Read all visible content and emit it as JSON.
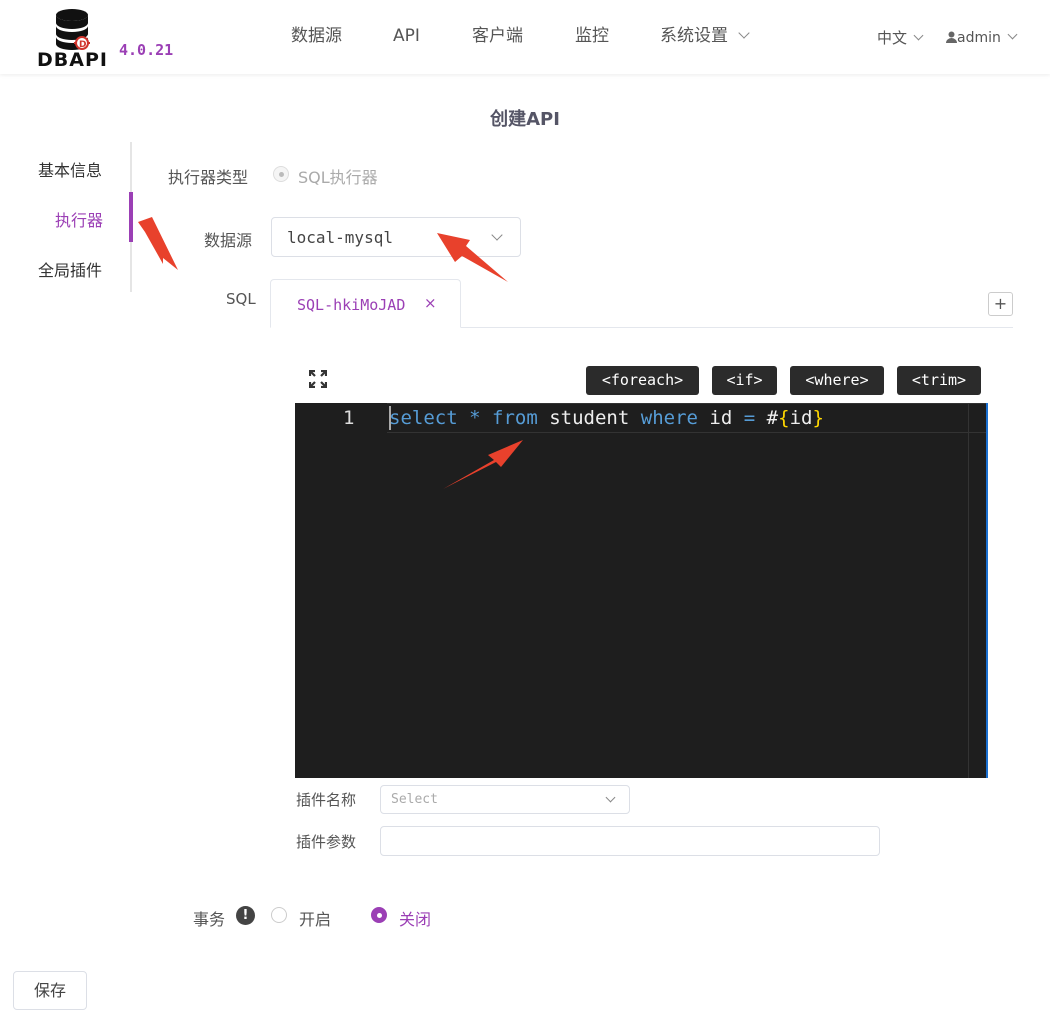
{
  "brand": {
    "name": "DBAPI",
    "version": "4.0.21"
  },
  "nav": {
    "items": [
      "数据源",
      "API",
      "客户端",
      "监控",
      "系统设置"
    ],
    "language": "中文",
    "user": "admin"
  },
  "page_title": "创建API",
  "side_menu": {
    "items": [
      "基本信息",
      "执行器",
      "全局插件"
    ],
    "active": "执行器"
  },
  "form": {
    "executor_type_label": "执行器类型",
    "executor_type_value": "SQL执行器",
    "datasource_label": "数据源",
    "datasource_value": "local-mysql",
    "sql_label": "SQL",
    "sql_tabs": [
      {
        "label": "SQL-hkiMoJAD",
        "close": "×"
      }
    ],
    "add_tab_label": "+",
    "tag_buttons": [
      "<foreach>",
      "<if>",
      "<where>",
      "<trim>"
    ],
    "editor": {
      "line_number": "1",
      "tokens": {
        "select": "select",
        "star": "*",
        "from": "from",
        "table": "student",
        "where": "where",
        "col": "id",
        "eq": "=",
        "hash": "#",
        "lbrace": "{",
        "param": "id",
        "rbrace": "}"
      }
    },
    "plugin_name_label": "插件名称",
    "plugin_name_placeholder": "Select",
    "plugin_param_label": "插件参数",
    "transaction_label": "事务",
    "transaction_options": [
      "开启",
      "关闭"
    ],
    "transaction_selected": "关闭",
    "save_label": "保存"
  },
  "colors": {
    "accent": "#9b3fb5",
    "editor_bg": "#1e1e1e",
    "annotation_arrow": "#e8412c"
  }
}
